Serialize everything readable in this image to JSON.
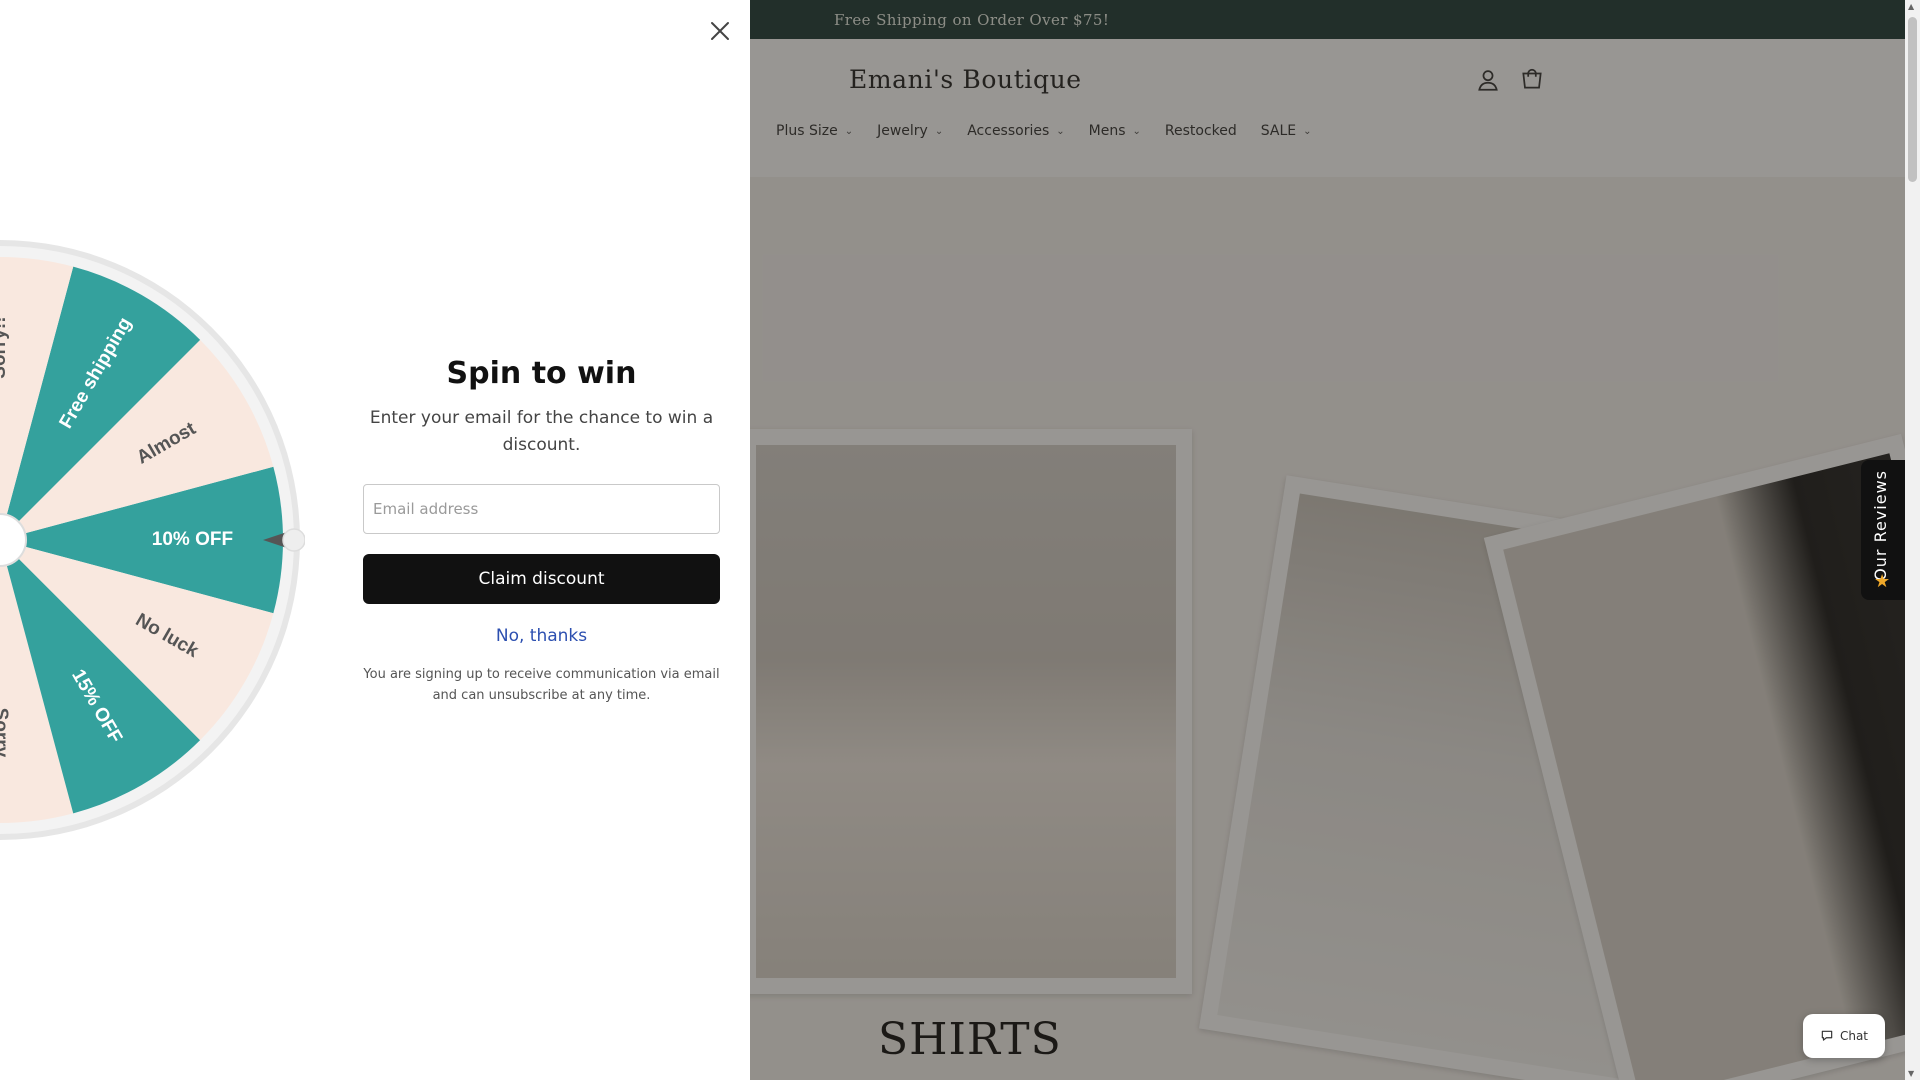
{
  "store": {
    "announcement": "Free Shipping on Order Over $75!",
    "logo": "Emani's Boutique",
    "nav": [
      {
        "label": "Plus Size",
        "has_dropdown": true
      },
      {
        "label": "Jewelry",
        "has_dropdown": true
      },
      {
        "label": "Accessories",
        "has_dropdown": true
      },
      {
        "label": "Mens",
        "has_dropdown": true
      },
      {
        "label": "Restocked",
        "has_dropdown": false
      },
      {
        "label": "SALE",
        "has_dropdown": true
      }
    ],
    "header_icons": [
      "account-icon",
      "cart-icon"
    ],
    "hero_title": "SHIRTS",
    "reviews_tab": "Our Reviews",
    "chat_label": "Chat"
  },
  "popup": {
    "title": "Spin to win",
    "subtitle": "Enter your email for the chance to win a discount.",
    "email_placeholder": "Email address",
    "claim_label": "Claim discount",
    "no_thanks": "No, thanks",
    "disclaimer": "You are signing up to receive communication via email and can unsubscribe at any time.",
    "close_icon": "close-icon"
  },
  "wheel": {
    "colors": {
      "teal": "#34a19d",
      "cream": "#f9e8df"
    },
    "slices": [
      {
        "label": "10% OFF",
        "color": "teal"
      },
      {
        "label": "Almost",
        "color": "cream"
      },
      {
        "label": "Free shipping",
        "color": "teal"
      },
      {
        "label": "Sorry!!",
        "color": "cream"
      },
      {
        "label": "",
        "color": "teal"
      },
      {
        "label": "",
        "color": "cream"
      },
      {
        "label": "",
        "color": "teal"
      },
      {
        "label": "",
        "color": "cream"
      },
      {
        "label": "",
        "color": "teal"
      },
      {
        "label": "Sorry",
        "color": "cream"
      },
      {
        "label": "15% OFF",
        "color": "teal"
      },
      {
        "label": "No luck",
        "color": "cream"
      }
    ]
  }
}
